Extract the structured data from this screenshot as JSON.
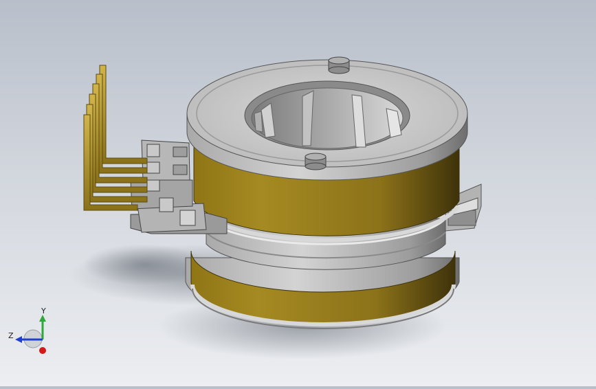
{
  "viewport": {
    "background_top": "#b8bfca",
    "background_bottom": "#eceef1",
    "model": {
      "description_icon": "slip-ring-assembly",
      "coil_color": "#a58a22",
      "metal_color": "#c9c9c9",
      "bracket_color": "#a8a8a8"
    }
  },
  "triad": {
    "x_label": "",
    "y_label": "Y",
    "z_label": "Z",
    "y_color": "#2fa83a",
    "z_color": "#1f3fd0",
    "x_color": "#d21a1a"
  }
}
